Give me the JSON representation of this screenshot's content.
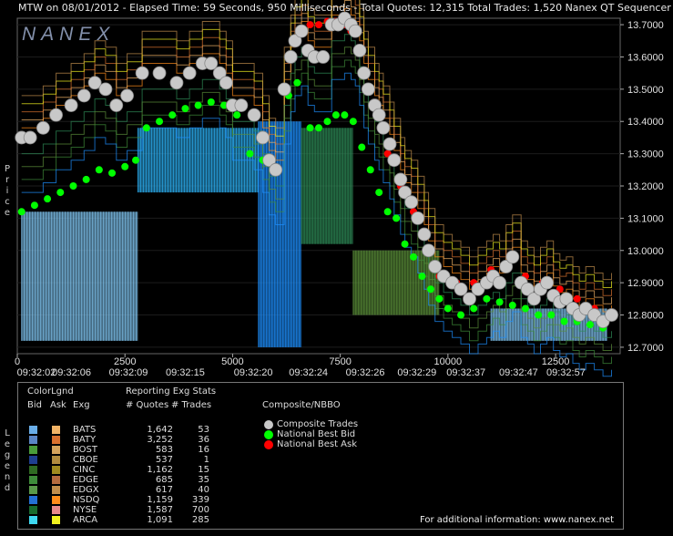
{
  "header": {
    "text": "MTW on 08/01/2012  -  Elapsed Time: 59 Seconds, 950 Milliseconds  -  Total Quotes: 12,315  Total Trades: 1,520 Nanex QT Sequencer G4"
  },
  "watermark": "NANEX",
  "price_axis_title": "Price",
  "legend_axis_title": "Legend",
  "chart_data": {
    "type": "scatter",
    "title": "",
    "xlabel": "",
    "ylabel": "Price",
    "xlim": [
      0,
      14000
    ],
    "ylim": [
      12.68,
      13.72
    ],
    "yticks": [
      "13.7000",
      "13.6000",
      "13.5000",
      "13.4000",
      "13.3000",
      "13.2000",
      "13.1000",
      "13.0000",
      "12.9000",
      "12.8000",
      "12.7000"
    ],
    "ytick_values": [
      13.7,
      13.6,
      13.5,
      13.4,
      13.3,
      13.2,
      13.1,
      13.0,
      12.9,
      12.8,
      12.7
    ],
    "xticks_seq": [
      "0",
      "2500",
      "5000",
      "7500",
      "10000",
      "12500"
    ],
    "xticks_seq_values": [
      0,
      2500,
      5000,
      7500,
      10000,
      12500
    ],
    "xticks_time": [
      "09:32:02",
      "09:32:06",
      "09:32:09",
      "09:32:15",
      "09:32:20",
      "09:32:24",
      "09:32:26",
      "09:32:29",
      "09:32:37",
      "09:32:47",
      "09:32:57"
    ],
    "xticks_time_values": [
      0,
      1260,
      2580,
      3900,
      5480,
      6760,
      8080,
      9280,
      10420,
      11640,
      12740
    ],
    "series": [
      {
        "name": "Composite Trades",
        "color": "#c8c8c8",
        "x": [
          100,
          300,
          600,
          900,
          1250,
          1550,
          1800,
          2050,
          2300,
          2550,
          2900,
          3300,
          3700,
          4000,
          4300,
          4500,
          4700,
          4850,
          5000,
          5200,
          5500,
          5700,
          5850,
          6000,
          6200,
          6350,
          6450,
          6600,
          6750,
          6900,
          7100,
          7300,
          7450,
          7600,
          7750,
          7850,
          7950,
          8050,
          8150,
          8300,
          8400,
          8500,
          8650,
          8750,
          8900,
          9000,
          9150,
          9300,
          9450,
          9550,
          9700,
          9900,
          10100,
          10300,
          10500,
          10700,
          10900,
          11050,
          11200,
          11350,
          11500,
          11700,
          11850,
          12000,
          12150,
          12300,
          12450,
          12600,
          12750,
          12900,
          13050,
          13200,
          13400,
          13600,
          13800
        ],
        "y": [
          13.35,
          13.35,
          13.38,
          13.42,
          13.45,
          13.48,
          13.52,
          13.5,
          13.45,
          13.48,
          13.55,
          13.55,
          13.52,
          13.55,
          13.58,
          13.58,
          13.55,
          13.52,
          13.45,
          13.45,
          13.42,
          13.35,
          13.28,
          13.25,
          13.5,
          13.6,
          13.65,
          13.68,
          13.62,
          13.6,
          13.6,
          13.7,
          13.7,
          13.72,
          13.7,
          13.68,
          13.62,
          13.55,
          13.5,
          13.45,
          13.42,
          13.38,
          13.33,
          13.28,
          13.22,
          13.18,
          13.15,
          13.1,
          13.05,
          13.0,
          12.95,
          12.92,
          12.9,
          12.88,
          12.85,
          12.88,
          12.9,
          12.92,
          12.9,
          12.95,
          12.98,
          12.9,
          12.88,
          12.85,
          12.88,
          12.9,
          12.86,
          12.84,
          12.85,
          12.82,
          12.8,
          12.82,
          12.8,
          12.78,
          12.8
        ]
      },
      {
        "name": "National Best Bid",
        "color": "#00ff00",
        "x": [
          100,
          400,
          700,
          1000,
          1300,
          1600,
          1900,
          2200,
          2500,
          2750,
          3000,
          3300,
          3600,
          3900,
          4200,
          4500,
          4800,
          5100,
          5400,
          5700,
          6000,
          6300,
          6500,
          6800,
          7000,
          7200,
          7400,
          7600,
          7800,
          8000,
          8200,
          8400,
          8600,
          8800,
          9000,
          9200,
          9400,
          9600,
          9800,
          10000,
          10300,
          10600,
          10900,
          11200,
          11500,
          11800,
          12100,
          12400,
          12700,
          13000,
          13300,
          13600
        ],
        "y": [
          13.12,
          13.14,
          13.16,
          13.18,
          13.2,
          13.22,
          13.25,
          13.24,
          13.26,
          13.28,
          13.38,
          13.4,
          13.42,
          13.44,
          13.45,
          13.46,
          13.45,
          13.42,
          13.3,
          13.28,
          13.25,
          13.48,
          13.52,
          13.38,
          13.38,
          13.4,
          13.42,
          13.42,
          13.4,
          13.32,
          13.25,
          13.18,
          13.12,
          13.1,
          13.02,
          12.98,
          12.92,
          12.88,
          12.85,
          12.82,
          12.8,
          12.82,
          12.85,
          12.84,
          12.83,
          12.82,
          12.8,
          12.8,
          12.78,
          12.78,
          12.77,
          12.76
        ]
      },
      {
        "name": "National Best Ask",
        "color": "#ff0000",
        "x": [
          6800,
          7000,
          7200,
          7400,
          7600,
          7750,
          8000,
          8300,
          8600,
          8900,
          9200,
          9500,
          9800,
          10200,
          10600,
          11000,
          11400,
          11800,
          12200,
          12600,
          13000,
          13400
        ],
        "y": [
          13.7,
          13.7,
          13.71,
          13.71,
          13.7,
          13.68,
          13.55,
          13.45,
          13.3,
          13.2,
          13.12,
          13.0,
          12.92,
          12.9,
          12.9,
          12.94,
          12.95,
          12.92,
          12.9,
          12.88,
          12.85,
          12.82
        ]
      }
    ],
    "exchange_quote_panels": [
      {
        "exchange": "BATS",
        "x_start": 100,
        "x_end": 2800,
        "low": 12.72,
        "high": 13.12,
        "color": "#7fc4f0"
      },
      {
        "exchange": "ARCA",
        "x_start": 2800,
        "x_end": 5600,
        "low": 13.18,
        "high": 13.38,
        "color": "#2aa8e8"
      },
      {
        "exchange": "NSDQ",
        "x_start": 5600,
        "x_end": 6600,
        "low": 12.7,
        "high": 13.4,
        "color": "#1e90ff"
      },
      {
        "exchange": "NYSE",
        "x_start": 6600,
        "x_end": 7800,
        "low": 13.02,
        "high": 13.38,
        "color": "#2e8b57"
      },
      {
        "exchange": "EDGX",
        "x_start": 7800,
        "x_end": 9800,
        "low": 12.8,
        "high": 13.0,
        "color": "#5b8f3a"
      },
      {
        "exchange": "BATS",
        "x_start": 11000,
        "x_end": 13700,
        "low": 12.72,
        "high": 12.82,
        "color": "#7fc4f0"
      }
    ]
  },
  "legend": {
    "title": "ColorLgnd",
    "col_bid": "Bid",
    "col_ask": "Ask",
    "col_exg": "Exg",
    "stats_title": "Reporting Exg Stats",
    "col_quotes": "# Quotes",
    "col_trades": "# Trades",
    "nbbo_title": "Composite/NBBO",
    "exchanges": [
      {
        "exg": "BATS",
        "quotes": "1,642",
        "trades": "53",
        "bid": "#6aaee8",
        "ask": "#f2b366"
      },
      {
        "exg": "BATY",
        "quotes": "3,252",
        "trades": "36",
        "bid": "#5b86c6",
        "ask": "#d9702e"
      },
      {
        "exg": "BOST",
        "quotes": "583",
        "trades": "16",
        "bid": "#4a9c3a",
        "ask": "#d4a35c"
      },
      {
        "exg": "CBOE",
        "quotes": "537",
        "trades": "1",
        "bid": "#1f3e8f",
        "ask": "#b08b3e"
      },
      {
        "exg": "CINC",
        "quotes": "1,162",
        "trades": "15",
        "bid": "#2f6a22",
        "ask": "#9f8a1f"
      },
      {
        "exg": "EDGE",
        "quotes": "685",
        "trades": "35",
        "bid": "#3e8c3a",
        "ask": "#b46a3e"
      },
      {
        "exg": "EDGX",
        "quotes": "617",
        "trades": "40",
        "bid": "#5a9a4a",
        "ask": "#c18d4b"
      },
      {
        "exg": "NSDQ",
        "quotes": "1,159",
        "trades": "339",
        "bid": "#2470d6",
        "ask": "#ff8c1a"
      },
      {
        "exg": "NYSE",
        "quotes": "1,587",
        "trades": "700",
        "bid": "#196b2e",
        "ask": "#e78a8a"
      },
      {
        "exg": "ARCA",
        "quotes": "1,091",
        "trades": "285",
        "bid": "#3fd9f2",
        "ask": "#f2f21f"
      }
    ],
    "nbbo": [
      {
        "label": "Composite Trades",
        "color": "#c8c8c8"
      },
      {
        "label": "National Best Bid",
        "color": "#00ff00"
      },
      {
        "label": "National Best Ask",
        "color": "#ff0000"
      }
    ],
    "footer": "For additional information: www.nanex.net"
  }
}
